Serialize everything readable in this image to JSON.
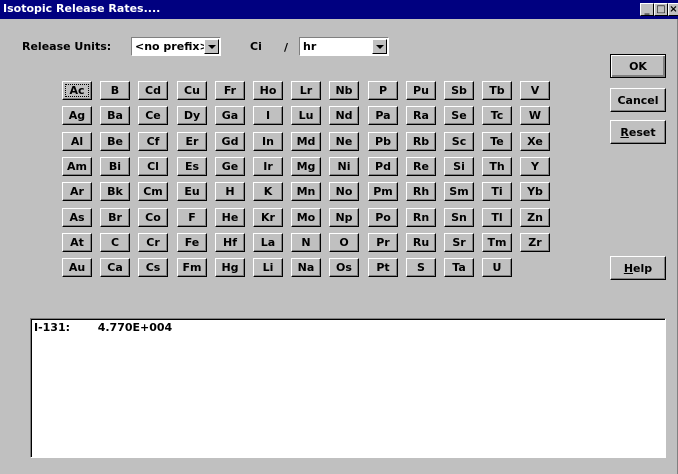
{
  "window": {
    "title": "Isotopic Release Rates...."
  },
  "titlebar_buttons": {
    "minimize": "_",
    "maximize": "□",
    "close": "×"
  },
  "units": {
    "label": "Release Units:",
    "prefix_value": "<no prefix>",
    "unit": "Ci",
    "separator": "/",
    "time_value": "hr"
  },
  "elements": [
    [
      "Ac",
      "B",
      "Cd",
      "Cu",
      "Fr",
      "Ho",
      "Lr",
      "Nb",
      "P",
      "Pu",
      "Sb",
      "Tb",
      "V"
    ],
    [
      "Ag",
      "Ba",
      "Ce",
      "Dy",
      "Ga",
      "I",
      "Lu",
      "Nd",
      "Pa",
      "Ra",
      "Se",
      "Tc",
      "W"
    ],
    [
      "Al",
      "Be",
      "Cf",
      "Er",
      "Gd",
      "In",
      "Md",
      "Ne",
      "Pb",
      "Rb",
      "Sc",
      "Te",
      "Xe"
    ],
    [
      "Am",
      "Bi",
      "Cl",
      "Es",
      "Ge",
      "Ir",
      "Mg",
      "Ni",
      "Pd",
      "Re",
      "Si",
      "Th",
      "Y"
    ],
    [
      "Ar",
      "Bk",
      "Cm",
      "Eu",
      "H",
      "K",
      "Mn",
      "No",
      "Pm",
      "Rh",
      "Sm",
      "Ti",
      "Yb"
    ],
    [
      "As",
      "Br",
      "Co",
      "F",
      "He",
      "Kr",
      "Mo",
      "Np",
      "Po",
      "Rn",
      "Sn",
      "Tl",
      "Zn"
    ],
    [
      "At",
      "C",
      "Cr",
      "Fe",
      "Hf",
      "La",
      "N",
      "O",
      "Pr",
      "Ru",
      "Sr",
      "Tm",
      "Zr"
    ],
    [
      "Au",
      "Ca",
      "Cs",
      "Fm",
      "Hg",
      "Li",
      "Na",
      "Os",
      "Pt",
      "S",
      "Ta",
      "U"
    ]
  ],
  "actions": {
    "ok": "OK",
    "cancel": "Cancel",
    "reset_mnemonic": "R",
    "reset_rest": "eset",
    "help_mnemonic": "H",
    "help_rest": "elp"
  },
  "output": {
    "entries": [
      {
        "isotope": "I-131:",
        "value": "4.770E+004"
      }
    ]
  }
}
